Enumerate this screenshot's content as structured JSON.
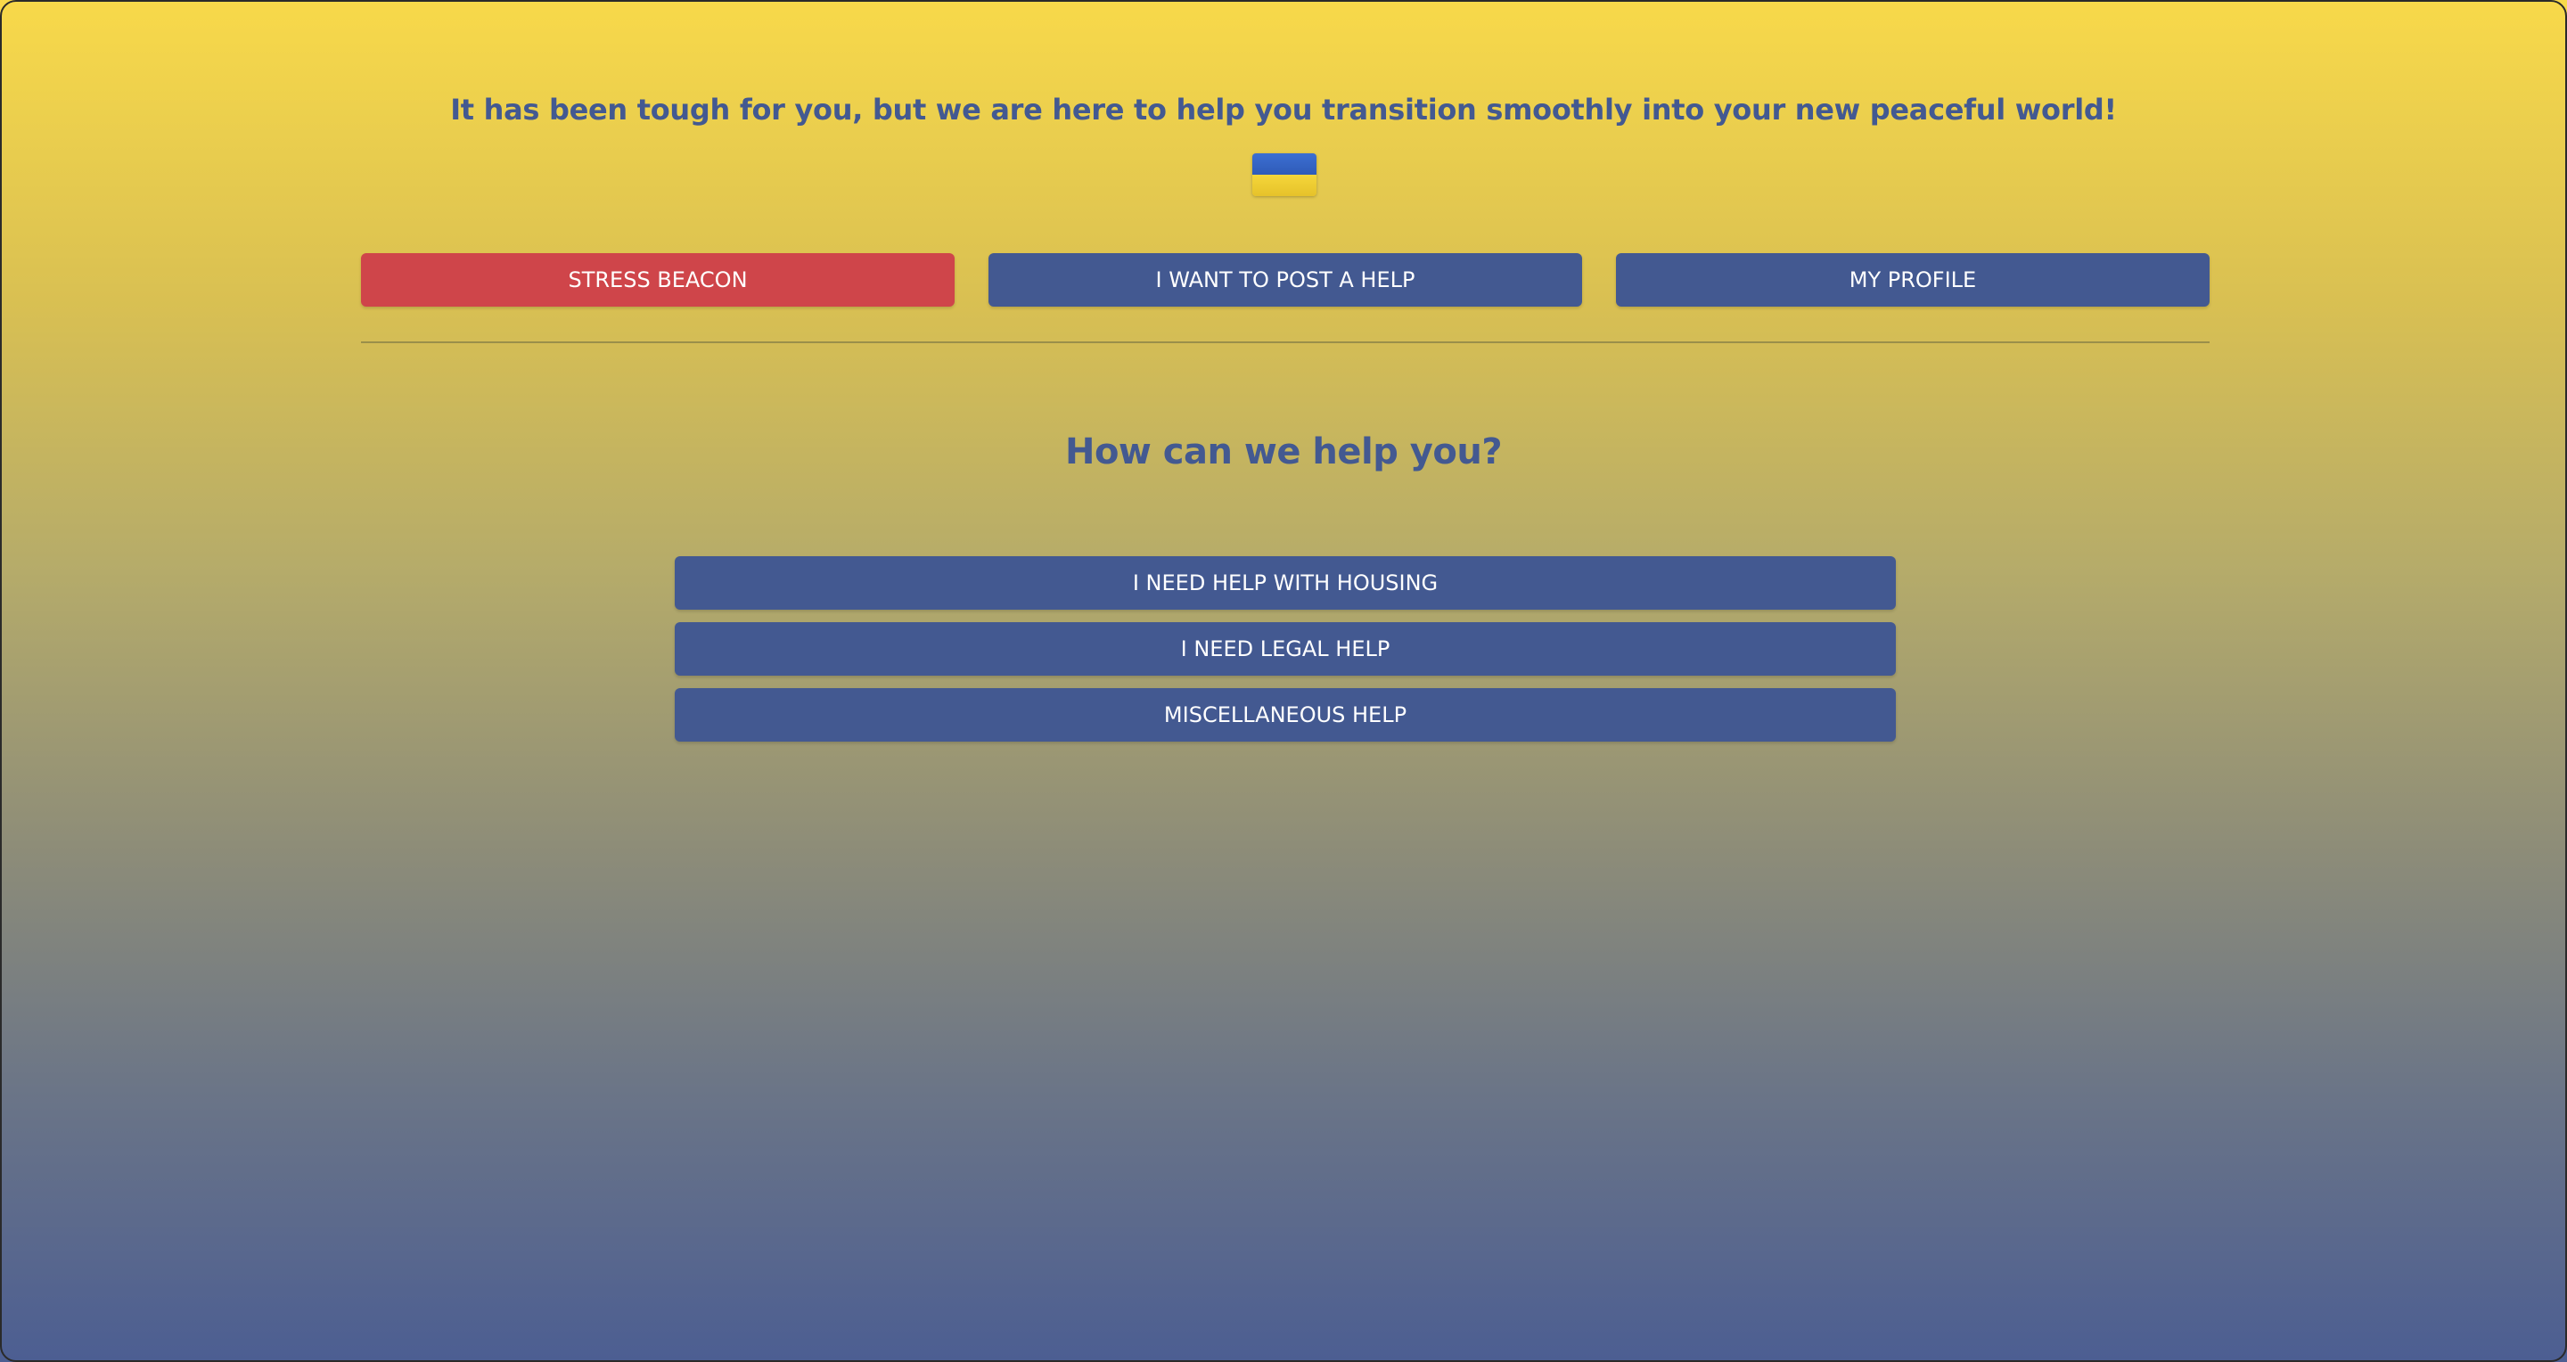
{
  "header": {
    "tagline": "It has been tough for you, but we are here to help you transition smoothly into your new peaceful world!",
    "flag_icon": "ukraine-flag-icon",
    "flag_colors": {
      "top": "#2f5bb8",
      "bottom": "#f5d63a"
    }
  },
  "nav": {
    "stress_beacon_label": "STRESS BEACON",
    "post_help_label": "I WANT TO POST A HELP",
    "profile_label": "MY PROFILE"
  },
  "main": {
    "question": "How can we help you?",
    "options": [
      {
        "label": "I NEED HELP WITH HOUSING"
      },
      {
        "label": "I NEED LEGAL HELP"
      },
      {
        "label": "MISCELLANEOUS HELP"
      }
    ]
  },
  "colors": {
    "accent_blue": "#435991",
    "alert_red": "#cf454a",
    "background_top": "#f8d94a",
    "background_bottom": "#4c5e92"
  }
}
